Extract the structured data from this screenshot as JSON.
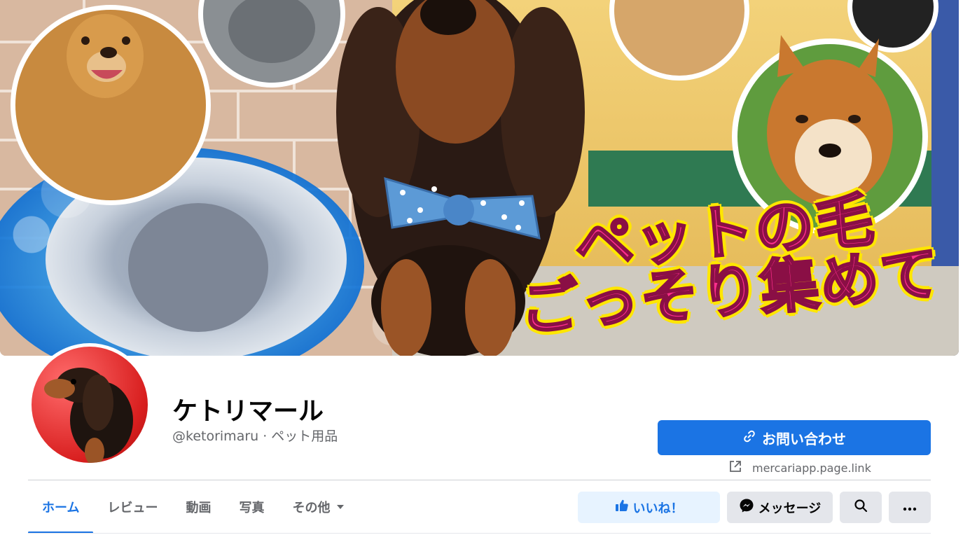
{
  "cover": {
    "headline_line1": "ペットの毛",
    "headline_line2": "ごっそり集めて"
  },
  "profile": {
    "name": "ケトリマール",
    "meta": "@ketorimaru · ペット用品"
  },
  "contact": {
    "label": "お問い合わせ",
    "link_text": "mercariapp.page.link"
  },
  "tabs": [
    {
      "label": "ホーム",
      "active": true
    },
    {
      "label": "レビュー",
      "active": false
    },
    {
      "label": "動画",
      "active": false
    },
    {
      "label": "写真",
      "active": false
    },
    {
      "label": "その他",
      "active": false
    }
  ],
  "actions": {
    "like_label": "いいね！",
    "message_label": "メッセージ"
  },
  "colors": {
    "accent": "#1b74e4",
    "accent_light": "#e7f3ff",
    "button_gray": "#e4e6eb",
    "muted_text": "#65676b",
    "headline_pink": "#ff2f8e",
    "headline_yellow": "#ffe600"
  },
  "icons": {
    "contact": "link-icon",
    "external_link": "external-link-icon",
    "like": "thumbs-up-icon",
    "message": "messenger-icon",
    "search": "search-icon",
    "more": "more-dots-icon",
    "tab_more": "caret-down-icon"
  }
}
